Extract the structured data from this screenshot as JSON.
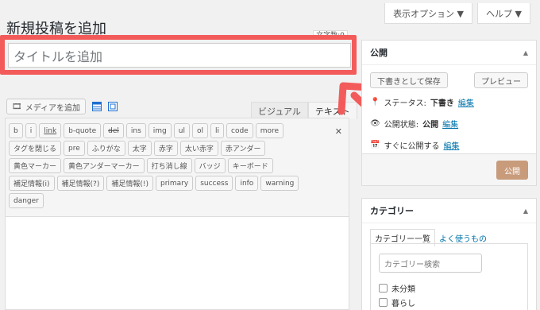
{
  "screen_options": {
    "display_options_label": "表示オプション ▼",
    "help_label": "ヘルプ ▼"
  },
  "page_title": "新規投稿を追加",
  "char_count_label": "文字数:0",
  "title_field": {
    "placeholder": "タイトルを追加"
  },
  "media": {
    "add_media_label": "メディアを追加"
  },
  "editor_tabs": {
    "visual": "ビジュアル",
    "text": "テキスト"
  },
  "quicktags": {
    "row1": [
      "b",
      "i",
      "link",
      "b-quote",
      "del",
      "ins",
      "img",
      "ul",
      "ol",
      "li",
      "code",
      "more"
    ],
    "row2": [
      "タグを閉じる",
      "pre",
      "ふりがな",
      "太字",
      "赤字",
      "太い赤字",
      "赤アンダー"
    ],
    "row3": [
      "黄色マーカー",
      "黄色アンダーマーカー",
      "打ち消し線",
      "バッジ",
      "キーボード"
    ],
    "row4": [
      "補足情報(i)",
      "補足情報(?)",
      "補足情報(!)",
      "primary",
      "success",
      "info",
      "warning"
    ],
    "row5": [
      "danger"
    ]
  },
  "publish": {
    "title": "公開",
    "save_draft": "下書きとして保存",
    "preview": "プレビュー",
    "status_label": "ステータス:",
    "status_value": "下書き",
    "status_edit": "編集",
    "visibility_label": "公開状態:",
    "visibility_value": "公開",
    "visibility_edit": "編集",
    "schedule_label": "すぐに公開する",
    "schedule_edit": "編集",
    "publish_button": "公開"
  },
  "categories": {
    "title": "カテゴリー",
    "tab_all": "カテゴリー一覧",
    "tab_popular": "よく使うもの",
    "search_placeholder": "カテゴリー検索",
    "items": [
      "未分類",
      "暮らし"
    ]
  },
  "colors": {
    "highlight_red": "#f35b5b",
    "link_blue": "#0073aa",
    "publish_button_bg": "#c89b7b"
  }
}
